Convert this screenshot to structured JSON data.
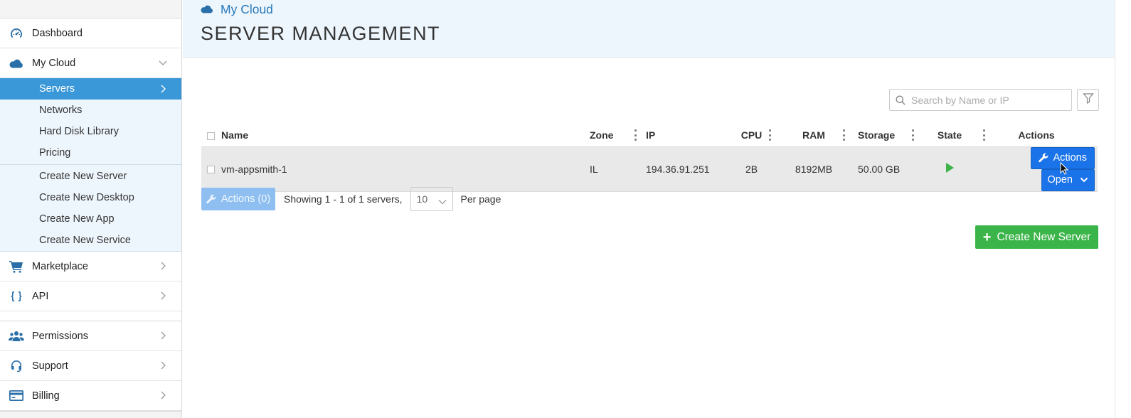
{
  "sidebar": {
    "items": [
      {
        "label": "Dashboard",
        "icon": "dashboard-icon"
      },
      {
        "label": "My Cloud",
        "icon": "cloud-icon"
      }
    ],
    "submenu": [
      {
        "label": "Servers",
        "active": true
      },
      {
        "label": "Networks"
      },
      {
        "label": "Hard Disk Library"
      },
      {
        "label": "Pricing"
      }
    ],
    "create_menu": [
      {
        "label": "Create New Server"
      },
      {
        "label": "Create New Desktop"
      },
      {
        "label": "Create New App"
      },
      {
        "label": "Create New Service"
      }
    ],
    "lower_items": [
      {
        "label": "Marketplace",
        "icon": "cart-icon"
      },
      {
        "label": "API",
        "icon": "braces-icon"
      },
      {
        "label": "Permissions",
        "icon": "users-icon"
      },
      {
        "label": "Support",
        "icon": "headset-icon"
      },
      {
        "label": "Billing",
        "icon": "credit-card-icon"
      }
    ]
  },
  "header": {
    "breadcrumb": "My Cloud",
    "title": "SERVER MANAGEMENT"
  },
  "search": {
    "placeholder": "Search by Name or IP"
  },
  "table": {
    "headers": {
      "name": "Name",
      "zone": "Zone",
      "ip": "IP",
      "cpu": "CPU",
      "ram": "RAM",
      "storage": "Storage",
      "state": "State",
      "actions": "Actions"
    },
    "rows": [
      {
        "name": "vm-appsmith-1",
        "zone": "IL",
        "ip": "194.36.91.251",
        "cpu": "2B",
        "ram": "8192MB",
        "storage": "50.00 GB",
        "state": "running",
        "actions_label": "Actions",
        "open_label": "Open"
      }
    ]
  },
  "pager": {
    "bulk_actions_label": "Actions (0)",
    "showing_text": "Showing 1 - 1 of 1 servers,",
    "per_page_value": "10",
    "per_page_label": "Per page"
  },
  "create_button": {
    "label": "Create New Server"
  },
  "colors": {
    "accent": "#3a98d8",
    "primary_button": "#1a73e8",
    "success": "#3bb54a",
    "header_bg": "#eef6fd"
  }
}
